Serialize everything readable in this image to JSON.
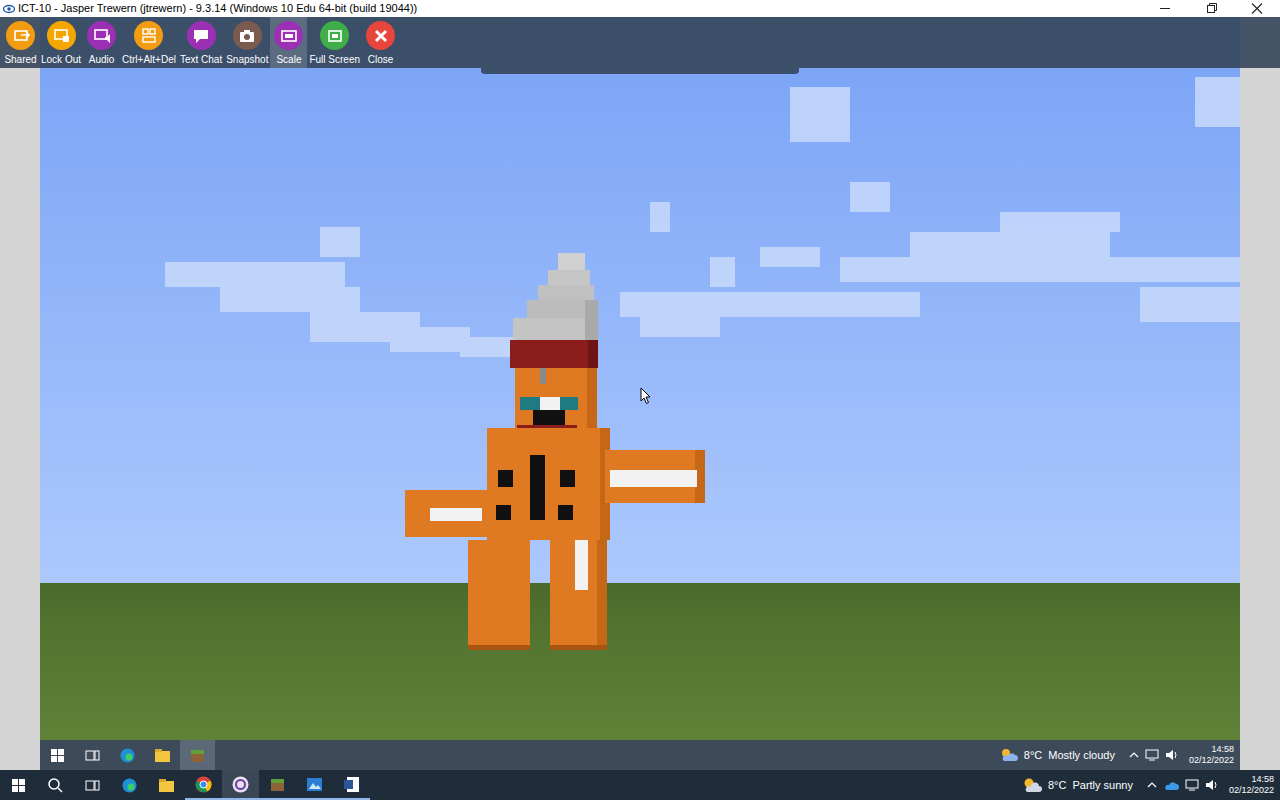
{
  "window": {
    "title": "ICT-10 - Jasper Trewern (jtrewern) - 9.3.14 (Windows 10 Edu 64-bit (build 19044))"
  },
  "toolbar": {
    "buttons": [
      {
        "label": "Shared",
        "color": "#f39c12",
        "selected": false
      },
      {
        "label": "Lock Out",
        "color": "#f5a700",
        "selected": false
      },
      {
        "label": "Audio",
        "color": "#9b30b5",
        "selected": false
      },
      {
        "label": "Ctrl+Alt+Del",
        "color": "#f39c12",
        "selected": false
      },
      {
        "label": "Text Chat",
        "color": "#9b30b5",
        "selected": false
      },
      {
        "label": "Snapshot",
        "color": "#7b5a4f",
        "selected": false
      },
      {
        "label": "Scale",
        "color": "#9b30b5",
        "selected": true
      },
      {
        "label": "Full Screen",
        "color": "#3fae49",
        "selected": false
      },
      {
        "label": "Close",
        "color": "#e8453c",
        "selected": false
      }
    ]
  },
  "remote_taskbar": {
    "apps": [
      {
        "selected": false
      },
      {
        "selected": false
      },
      {
        "selected": false
      },
      {
        "selected": false
      },
      {
        "selected": true
      }
    ],
    "weather": {
      "temperature": "8°C",
      "condition": "Mostly cloudy"
    },
    "time": "14:58",
    "date": "02/12/2022"
  },
  "taskbar": {
    "weather": {
      "temperature": "8°C",
      "condition": "Partly sunny"
    },
    "time": "14:58",
    "date": "02/12/2022"
  }
}
